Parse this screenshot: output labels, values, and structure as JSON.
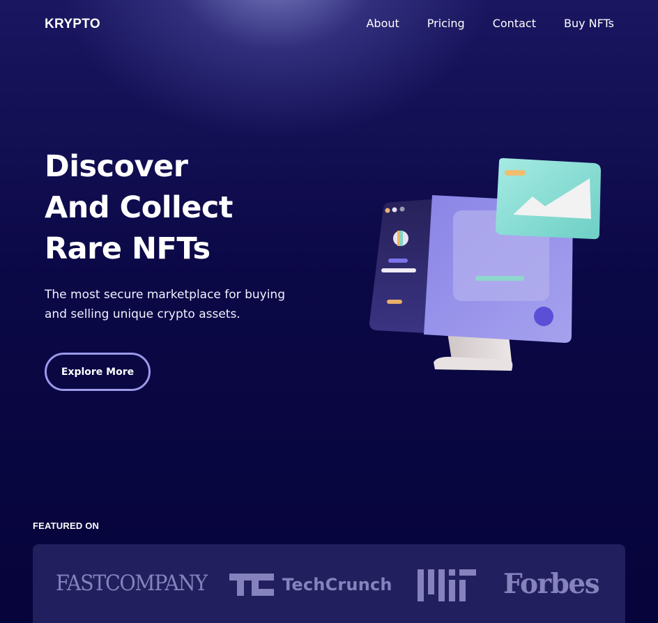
{
  "nav": {
    "logo": "KRYPTO",
    "links": [
      {
        "label": "About"
      },
      {
        "label": "Pricing"
      },
      {
        "label": "Contact"
      },
      {
        "label": "Buy NFTs"
      }
    ]
  },
  "hero": {
    "title_lines": [
      "Discover",
      "And Collect",
      "Rare NFTs"
    ],
    "subtitle": "The most secure marketplace for buying and selling unique crypto assets.",
    "cta_label": "Explore More"
  },
  "featured": {
    "label": "FEATURED ON",
    "brands": [
      "FASTCOMPANY",
      "TechCrunch",
      "MIT",
      "Forbes"
    ]
  },
  "colors": {
    "background": "#07053c",
    "accent": "#9d99ea",
    "card": "#221f5e",
    "brand_logo": "#8582bd",
    "monitor": "#8d87e6",
    "picture_card": "#7fd8cf"
  },
  "icons": [
    "nft-monitor-illustration",
    "image-card-icon"
  ]
}
